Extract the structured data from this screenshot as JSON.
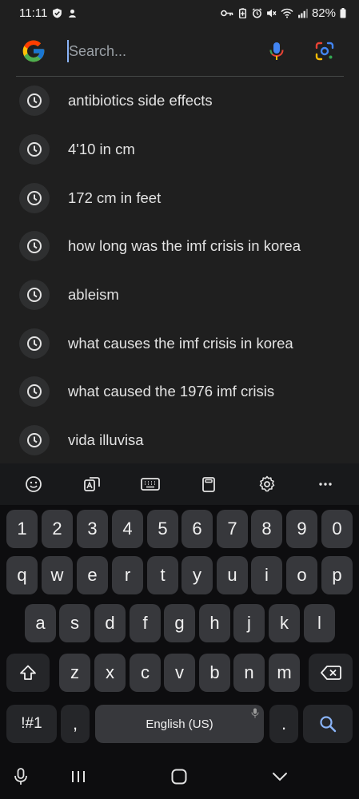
{
  "status": {
    "time": "11:11",
    "battery": "82%"
  },
  "search": {
    "placeholder": "Search..."
  },
  "suggestions": [
    "antibiotics side effects",
    "4'10 in cm",
    "172 cm in feet",
    "how long was the imf crisis in korea",
    "ableism",
    "what causes the imf crisis in korea",
    "what caused the 1976 imf crisis",
    "vida illuvisa"
  ],
  "keyboard": {
    "numbers": [
      "1",
      "2",
      "3",
      "4",
      "5",
      "6",
      "7",
      "8",
      "9",
      "0"
    ],
    "row1": [
      "q",
      "w",
      "e",
      "r",
      "t",
      "y",
      "u",
      "i",
      "o",
      "p"
    ],
    "row2": [
      "a",
      "s",
      "d",
      "f",
      "g",
      "h",
      "j",
      "k",
      "l"
    ],
    "row3": [
      "z",
      "x",
      "c",
      "v",
      "b",
      "n",
      "m"
    ],
    "symbols_key": "!#1",
    "comma_key": ",",
    "space_label": "English (US)",
    "period_key": "."
  },
  "colors": {
    "accent": "#8ab4f8",
    "background": "#1f1f1f",
    "key": "#37383c"
  }
}
